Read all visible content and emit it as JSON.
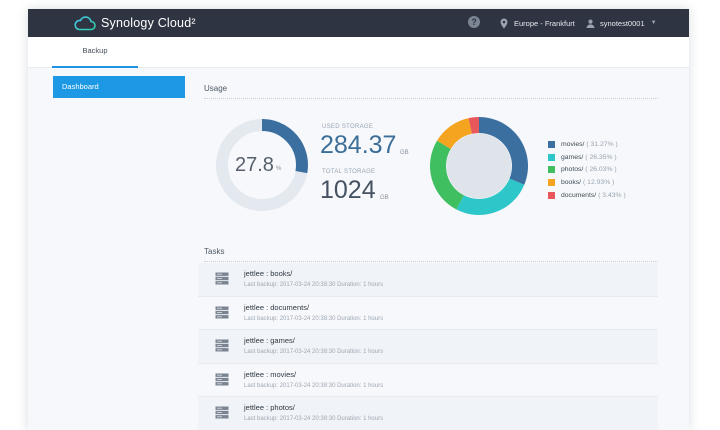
{
  "app": {
    "brand": "Synology Cloud²",
    "region": "Europe - Frankfurt",
    "user": "synotest0001"
  },
  "tabs": [
    {
      "label": "Backup"
    }
  ],
  "sidebar": {
    "items": [
      {
        "label": "Dashboard"
      }
    ]
  },
  "usage": {
    "title": "Usage",
    "percent_text": "27.8",
    "percent_unit": "%",
    "percent": 27.8,
    "used_label": "USED STORAGE",
    "used_value": "284.37",
    "used_unit": "GB",
    "total_label": "TOTAL STORAGE",
    "total_value": "1024",
    "total_unit": "GB"
  },
  "chart_data": {
    "type": "pie",
    "categories": [
      "movies/",
      "games/",
      "photos/",
      "books/",
      "documents/"
    ],
    "values": [
      31.27,
      26.35,
      26.03,
      12.93,
      3.43
    ],
    "labels": [
      "( 31.27% )",
      "( 26.35% )",
      "( 26.03% )",
      "( 12.93% )",
      "( 3.43% )"
    ],
    "colors": [
      "#3b6fa0",
      "#2ec7c9",
      "#3fbf5f",
      "#f4a41e",
      "#e8575a"
    ]
  },
  "tasks": {
    "title": "Tasks",
    "items": [
      {
        "name": "jettlee : books/",
        "meta": "Last backup: 2017-03-24 20:38:30 Duration: 1 hours"
      },
      {
        "name": "jettlee : documents/",
        "meta": "Last backup: 2017-03-24 20:38:30 Duration: 1 hours"
      },
      {
        "name": "jettlee : games/",
        "meta": "Last backup: 2017-03-24 20:38:30 Duration: 1 hours"
      },
      {
        "name": "jettlee : movies/",
        "meta": "Last backup: 2017-03-24 20:38:30 Duration: 1 hours"
      },
      {
        "name": "jettlee : photos/",
        "meta": "Last backup: 2017-03-24 20:38:30 Duration: 1 hours"
      }
    ]
  },
  "colors": {
    "topbar": "#2e3442",
    "accent": "#1c98e4",
    "gauge": "#3b6fa0",
    "gauge_track": "#e4e9ef"
  },
  "icons": {
    "logo": "cloud-icon",
    "help": "question-icon",
    "region": "location-pin-icon",
    "user": "user-icon",
    "task": "server-icon"
  }
}
